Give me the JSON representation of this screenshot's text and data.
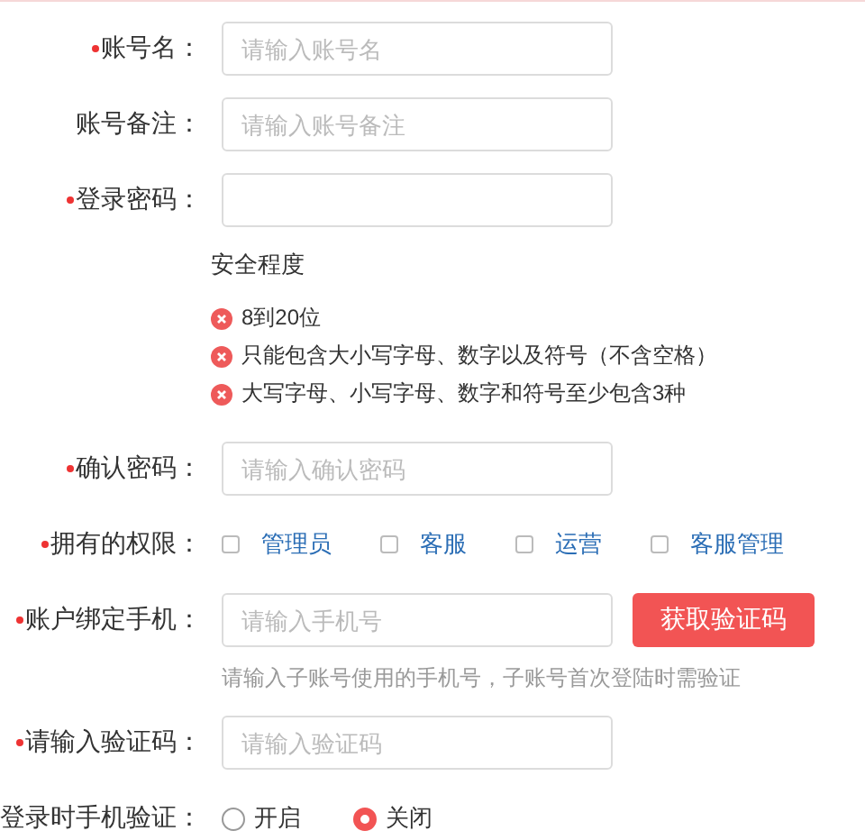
{
  "rows": [
    {
      "kind": "input",
      "label": "账号名：",
      "required": true,
      "placeholder": "请输入账号名"
    },
    {
      "kind": "input",
      "label": "账号备注：",
      "required": false,
      "placeholder": "请输入账号备注"
    },
    {
      "kind": "input",
      "label": "登录密码：",
      "required": true
    },
    {
      "kind": "strength",
      "title": "安全程度",
      "rules": [
        {
          "text": "8到20位",
          "passed": false
        },
        {
          "text": "只能包含大小写字母、数字以及符号（不含空格）",
          "passed": false
        },
        {
          "text": "大写字母、小写字母、数字和符号至少包含3种",
          "passed": false
        }
      ]
    },
    {
      "kind": "input",
      "label": "确认密码：",
      "required": true,
      "placeholder": "请输入确认密码"
    },
    {
      "kind": "checkboxes",
      "label": "拥有的权限：",
      "required": true,
      "options": [
        {
          "text": "管理员",
          "checked": false
        },
        {
          "text": "客服",
          "checked": false
        },
        {
          "text": "运营",
          "checked": false
        },
        {
          "text": "客服管理",
          "checked": false
        }
      ]
    },
    {
      "kind": "phone",
      "label": "账户绑定手机：",
      "required": true,
      "placeholder": "请输入手机号",
      "button": "获取验证码",
      "hint": "请输入子账号使用的手机号，子账号首次登陆时需验证"
    },
    {
      "kind": "input",
      "label": "请输入验证码：",
      "required": true,
      "placeholder": "请输入验证码"
    },
    {
      "kind": "radios",
      "label": "登录时手机验证：",
      "required": false,
      "options": [
        {
          "text": "开启",
          "selected": false
        },
        {
          "text": "关闭",
          "selected": true
        }
      ]
    }
  ]
}
